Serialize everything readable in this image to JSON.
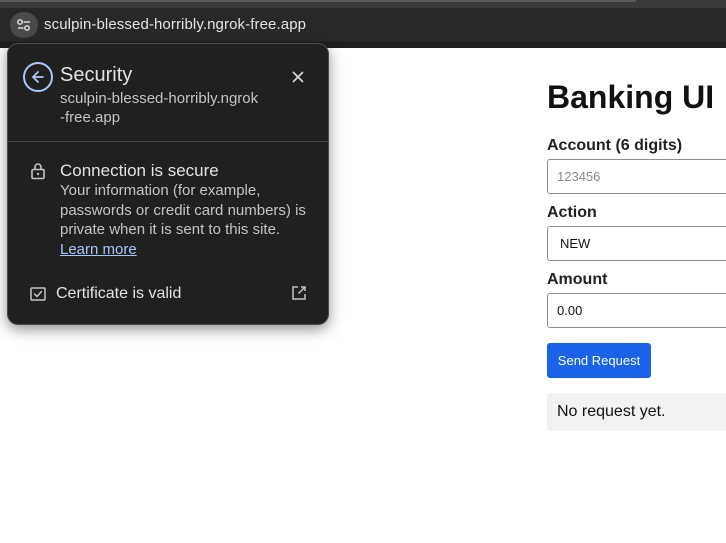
{
  "browser": {
    "url": "sculpin-blessed-horribly.ngrok-free.app"
  },
  "security_popup": {
    "title": "Security",
    "host": "sculpin-blessed-horribly.ngrok-free.app",
    "connection_title": "Connection is secure",
    "connection_desc": "Your information (for example, passwords or credit card numbers) is private when it is sent to this site.",
    "learn_more": "Learn more",
    "certificate_label": "Certificate is valid",
    "icons": [
      "back-arrow-icon",
      "close-icon",
      "lock-icon",
      "certificate-icon",
      "external-link-icon"
    ],
    "accent_color": "#a8c7fa"
  },
  "page": {
    "title": "Banking UI",
    "account_label": "Account (6 digits)",
    "account_placeholder": "123456",
    "action_label": "Action",
    "action_value": "NEW",
    "amount_label": "Amount",
    "amount_value": "0.00",
    "send_button": "Send Request",
    "result_text": "No request yet.",
    "button_color": "#1a63e8"
  }
}
